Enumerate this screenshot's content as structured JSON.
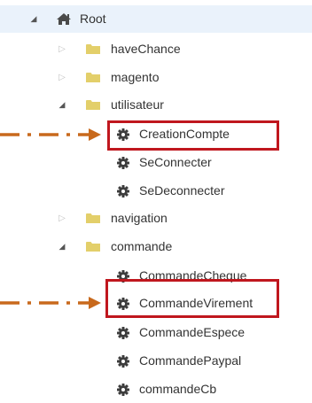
{
  "tree": {
    "root": {
      "label": "Root",
      "icon": "home-icon",
      "state": "expanded"
    },
    "nodes": [
      {
        "id": "haveChance",
        "label": "haveChance",
        "icon": "folder-icon",
        "state": "collapsed"
      },
      {
        "id": "magento",
        "label": "magento",
        "icon": "folder-icon",
        "state": "collapsed"
      },
      {
        "id": "utilisateur",
        "label": "utilisateur",
        "icon": "folder-icon",
        "state": "expanded"
      },
      {
        "id": "CreationCompte",
        "label": "CreationCompte",
        "icon": "gear-icon",
        "highlighted": true
      },
      {
        "id": "SeConnecter",
        "label": "SeConnecter",
        "icon": "gear-icon"
      },
      {
        "id": "SeDeconnecter",
        "label": "SeDeconnecter",
        "icon": "gear-icon"
      },
      {
        "id": "navigation",
        "label": "navigation",
        "icon": "folder-icon",
        "state": "collapsed"
      },
      {
        "id": "commande",
        "label": "commande",
        "icon": "folder-icon",
        "state": "expanded"
      },
      {
        "id": "CommandeCheque",
        "label": "CommandeCheque",
        "icon": "gear-icon"
      },
      {
        "id": "CommandeVirement",
        "label": "CommandeVirement",
        "icon": "gear-icon",
        "highlighted": true
      },
      {
        "id": "CommandeEspece",
        "label": "CommandeEspece",
        "icon": "gear-icon"
      },
      {
        "id": "CommandePaypal",
        "label": "CommandePaypal",
        "icon": "gear-icon"
      },
      {
        "id": "commandeCb",
        "label": "commandeCb",
        "icon": "gear-icon"
      }
    ]
  },
  "colors": {
    "selected_row_bg": "#eaf2fb",
    "folder": "#e3cf6a",
    "gear": "#3d3d3d",
    "home": "#4a4a4a",
    "highlight_box": "#c0171e",
    "annotation_arrow": "#c8691c"
  }
}
